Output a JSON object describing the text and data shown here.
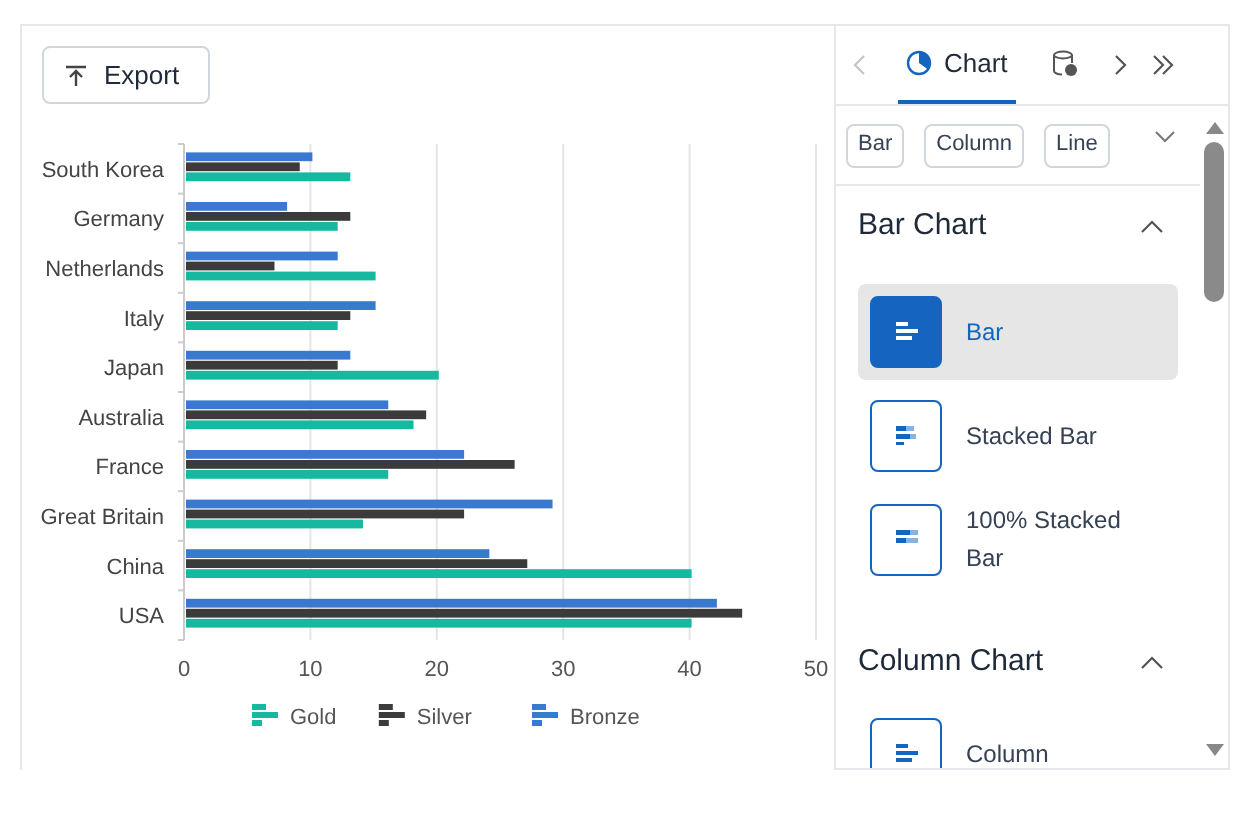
{
  "toolbar": {
    "export_button": "Export"
  },
  "chart": {
    "chart_data": {
      "type": "bar",
      "orientation": "horizontal",
      "categories": [
        "South Korea",
        "Germany",
        "Netherlands",
        "Italy",
        "Japan",
        "Australia",
        "France",
        "Great Britain",
        "China",
        "USA"
      ],
      "series": [
        {
          "name": "Gold",
          "color": "#16b8a0",
          "values": [
            13,
            12,
            15,
            12,
            20,
            18,
            16,
            14,
            40,
            40
          ]
        },
        {
          "name": "Silver",
          "color": "#3b3b3b",
          "values": [
            9,
            13,
            7,
            13,
            12,
            19,
            26,
            22,
            27,
            44
          ]
        },
        {
          "name": "Bronze",
          "color": "#3a79d0",
          "values": [
            10,
            8,
            12,
            15,
            13,
            16,
            22,
            29,
            24,
            42
          ]
        }
      ],
      "xlim": [
        0,
        50
      ],
      "xticks": [
        0,
        10,
        20,
        30,
        40,
        50
      ],
      "grid": true,
      "legend": true
    }
  },
  "panel": {
    "tabs": [
      {
        "kind": "chart",
        "label": "Chart",
        "selected": true
      },
      {
        "kind": "data",
        "selected": false
      }
    ],
    "chips": [
      "Bar",
      "Column",
      "Line"
    ],
    "sections": [
      {
        "title": "Bar Chart",
        "expanded": true,
        "items": [
          {
            "label": "Bar",
            "selected": true
          },
          {
            "label": "Stacked Bar",
            "selected": false
          },
          {
            "label": "100% Stacked Bar",
            "selected": false
          }
        ]
      },
      {
        "title": "Column Chart",
        "expanded": true,
        "items": [
          {
            "label": "Column",
            "selected": false
          }
        ]
      }
    ]
  }
}
